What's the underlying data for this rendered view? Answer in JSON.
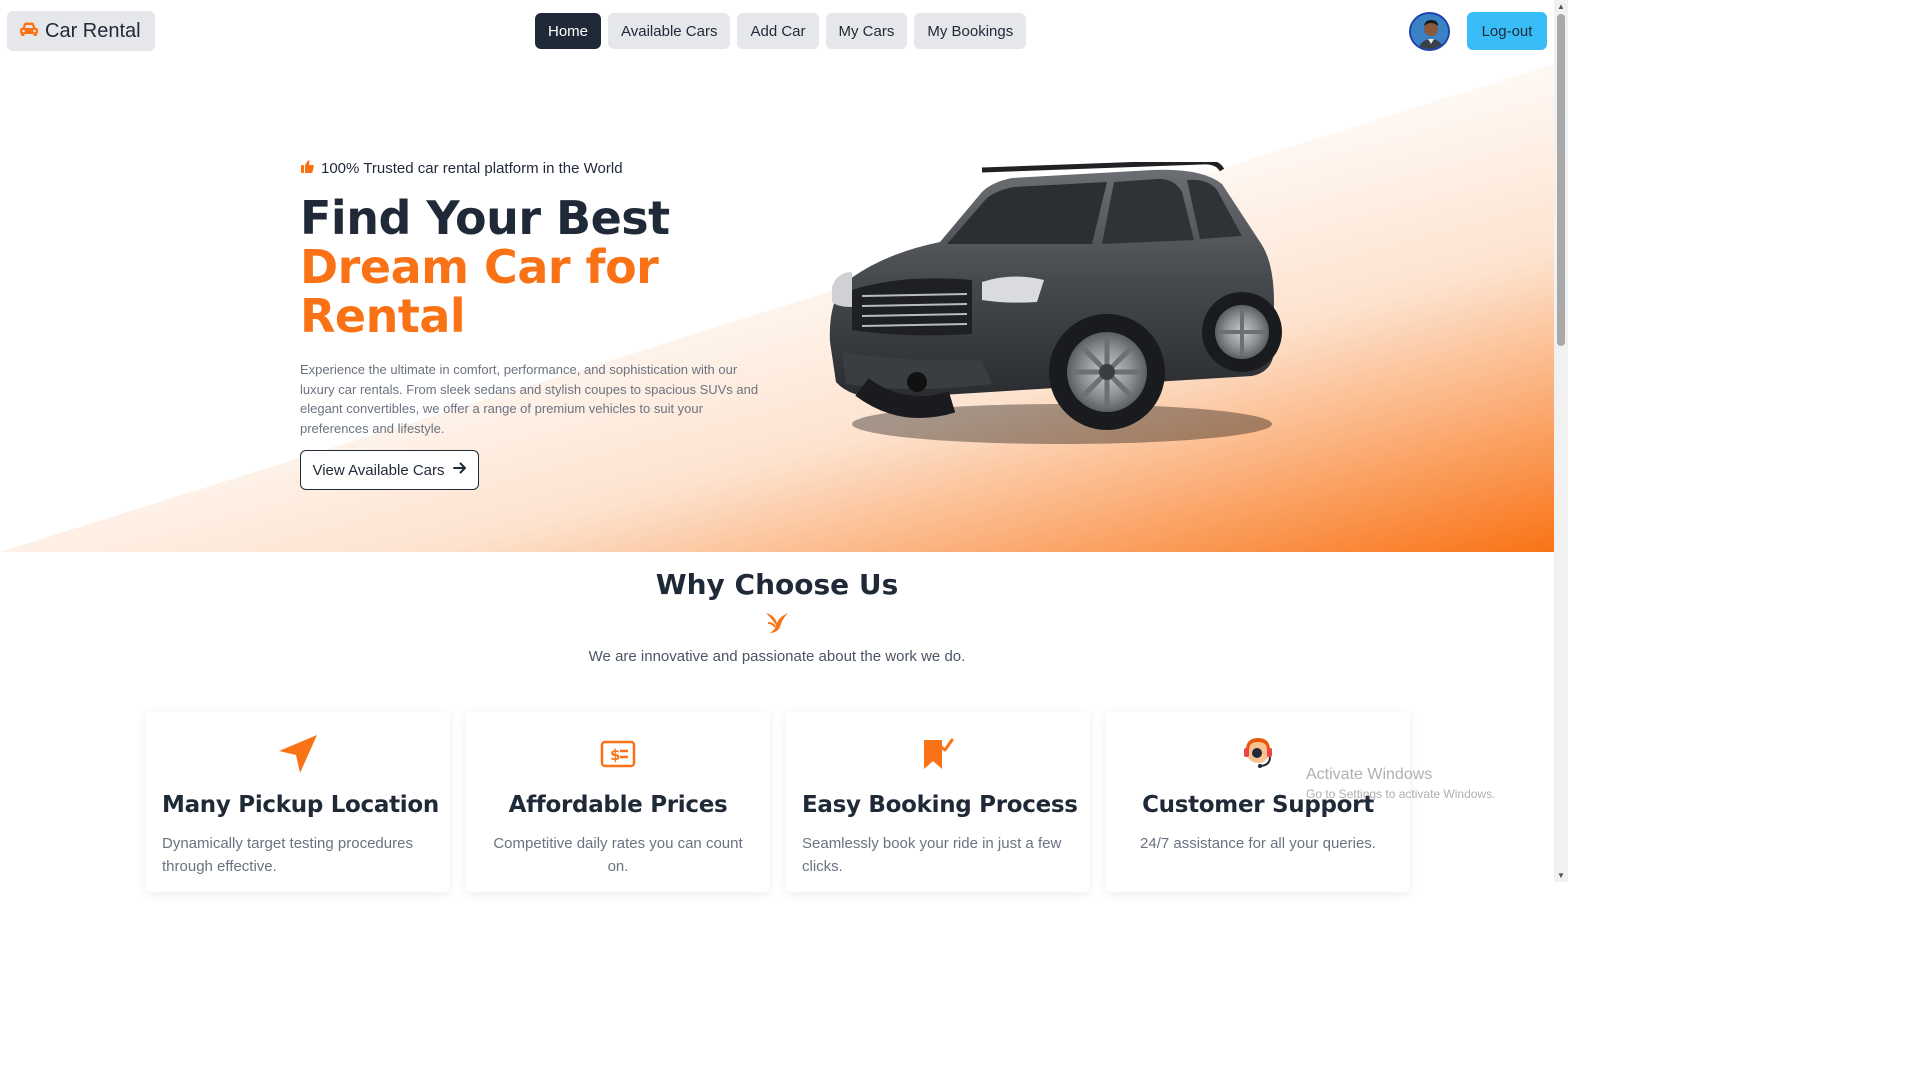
{
  "brand": {
    "name": "Car Rental",
    "icon": "car-icon"
  },
  "nav": {
    "items": [
      {
        "label": "Home",
        "active": true
      },
      {
        "label": "Available Cars",
        "active": false
      },
      {
        "label": "Add Car",
        "active": false
      },
      {
        "label": "My Cars",
        "active": false
      },
      {
        "label": "My Bookings",
        "active": false
      }
    ],
    "logout_label": "Log-out"
  },
  "hero": {
    "trust_text": "100% Trusted car rental platform in the World",
    "title_line1": "Find Your Best",
    "title_line2": "Dream Car for",
    "title_line3": "Rental",
    "description": "Experience the ultimate in comfort, performance, and sophistication with our luxury car rentals. From sleek sedans and stylish coupes to spacious SUVs and elegant convertibles, we offer a range of premium vehicles to suit your preferences and lifestyle.",
    "cta_label": "View Available Cars"
  },
  "why": {
    "title": "Why Choose Us",
    "subtitle": "We are innovative and passionate about the work we do.",
    "cards": [
      {
        "title": "Many Pickup Location",
        "description": "Dynamically target testing procedures through effective.",
        "icon": "location-arrow-icon"
      },
      {
        "title": "Affordable Prices",
        "description": "Competitive daily rates you can count on.",
        "icon": "dollar-bill-icon"
      },
      {
        "title": "Easy Booking Process",
        "description": "Seamlessly book your ride in just a few clicks.",
        "icon": "bookmark-check-icon"
      },
      {
        "title": "Customer Support",
        "description": "24/7 assistance for all your queries.",
        "icon": "headset-support-icon"
      }
    ]
  },
  "watermark": {
    "line1": "Activate Windows",
    "line2": "Go to Settings to activate Windows."
  },
  "colors": {
    "accent": "#f97316",
    "dark": "#1f2937",
    "logout": "#38bdf8",
    "nav_bg": "#e5e7eb"
  }
}
